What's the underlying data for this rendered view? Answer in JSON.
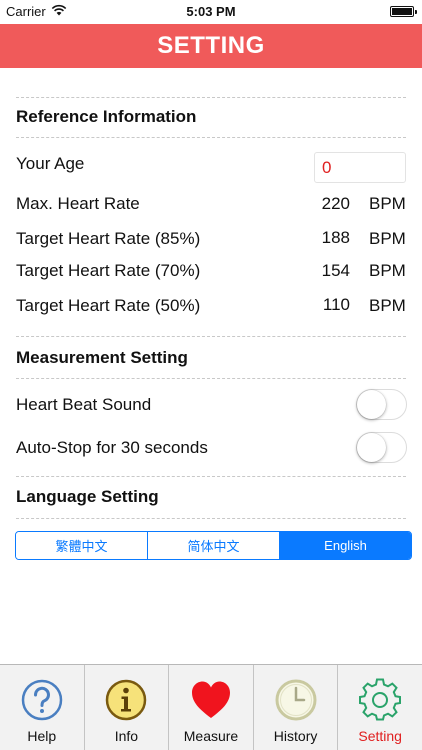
{
  "status_bar": {
    "carrier": "Carrier",
    "time": "5:03 PM"
  },
  "header": {
    "title": "SETTING",
    "color": "#f05a5a"
  },
  "reference": {
    "title": "Reference Information",
    "age": {
      "label": "Your Age",
      "value": "0"
    },
    "rows": [
      {
        "label": "Max. Heart Rate",
        "value": "220",
        "unit": "BPM"
      },
      {
        "label": "Target Heart Rate (85%)",
        "value": "188",
        "unit": "BPM"
      },
      {
        "label": "Target Heart Rate (70%)",
        "value": "154",
        "unit": "BPM"
      },
      {
        "label": "Target Heart Rate (50%)",
        "value": "110",
        "unit": "BPM"
      }
    ]
  },
  "measurement": {
    "title": "Measurement Setting",
    "heart_beat_sound": {
      "label": "Heart Beat Sound",
      "on": false
    },
    "auto_stop": {
      "label": "Auto-Stop for 30 seconds",
      "on": false
    }
  },
  "language": {
    "title": "Language Setting",
    "options": [
      "繁體中文",
      "简体中文",
      "English"
    ],
    "selected": "English",
    "accent": "#0a7aff"
  },
  "tabs": [
    {
      "label": "Help",
      "icon": "help-question-icon"
    },
    {
      "label": "Info",
      "icon": "info-icon"
    },
    {
      "label": "Measure",
      "icon": "heart-icon"
    },
    {
      "label": "History",
      "icon": "clock-icon"
    },
    {
      "label": "Setting",
      "icon": "gear-icon",
      "active": true
    }
  ]
}
